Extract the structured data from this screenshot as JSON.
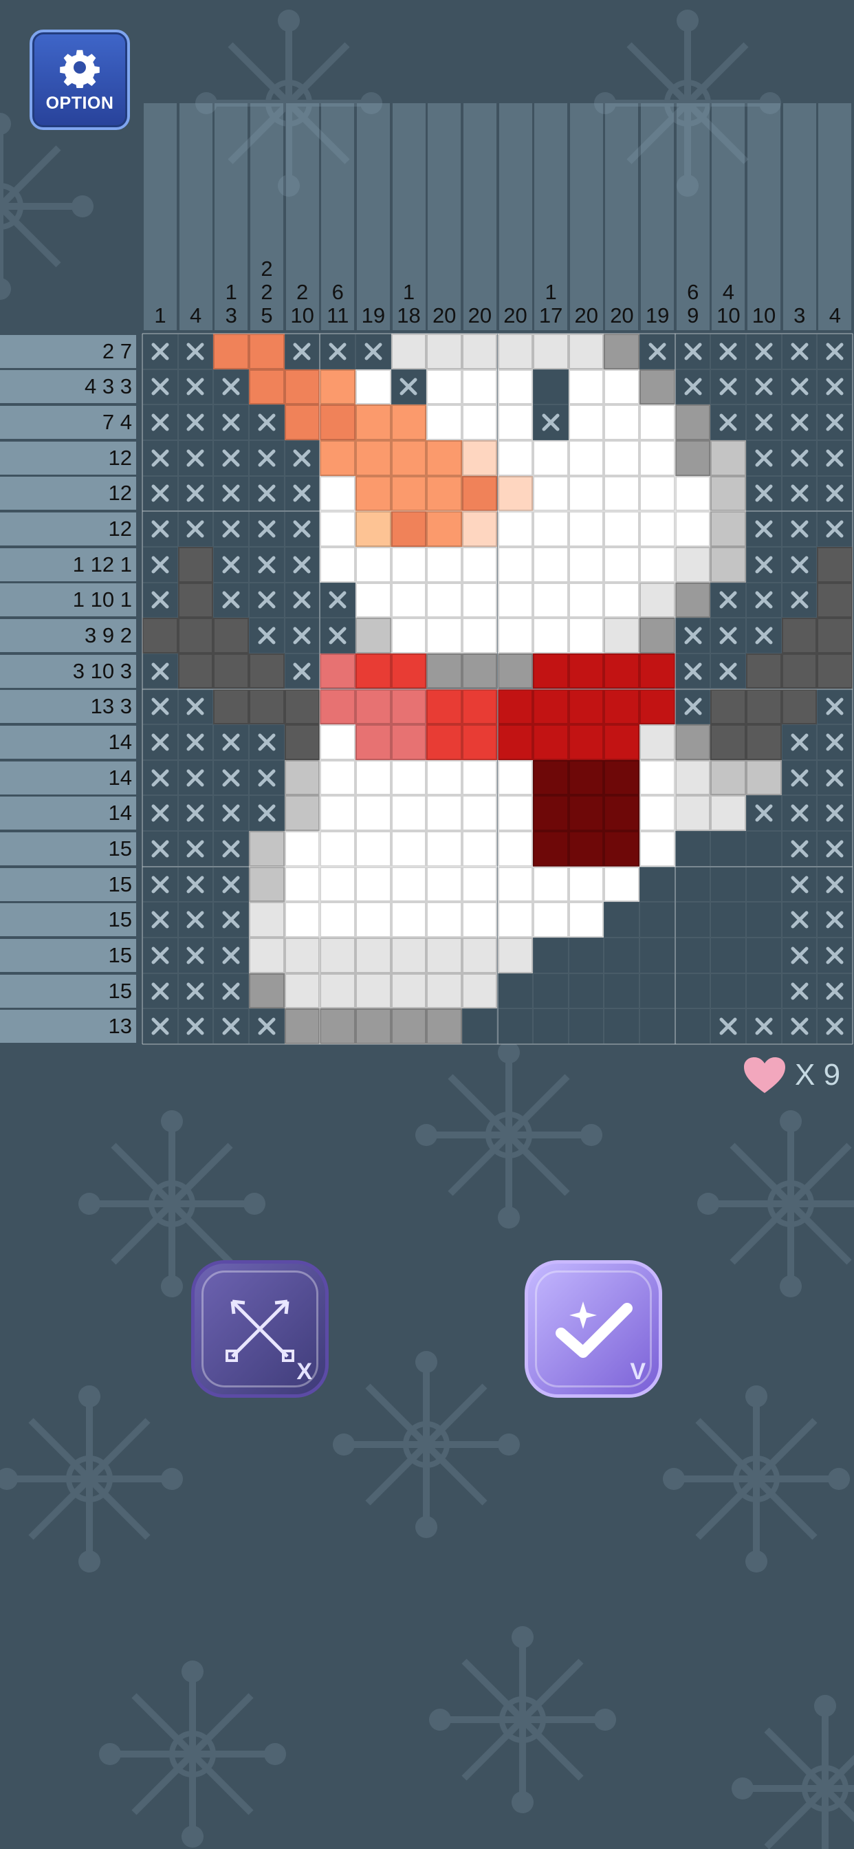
{
  "option_button": {
    "label": "OPTION",
    "icon": "gear-icon"
  },
  "column_clues": [
    [
      "1"
    ],
    [
      "4"
    ],
    [
      "1",
      "3"
    ],
    [
      "2",
      "2",
      "5"
    ],
    [
      "2",
      "10"
    ],
    [
      "6",
      "11"
    ],
    [
      "19"
    ],
    [
      "1",
      "18"
    ],
    [
      "20"
    ],
    [
      "20"
    ],
    [
      "20"
    ],
    [
      "1",
      "17"
    ],
    [
      "20"
    ],
    [
      "20"
    ],
    [
      "19"
    ],
    [
      "6",
      "9"
    ],
    [
      "4",
      "10"
    ],
    [
      "10"
    ],
    [
      "3"
    ],
    [
      "4"
    ]
  ],
  "row_clues": [
    "2 7",
    "4 3 3",
    "7 4",
    "12",
    "12",
    "12",
    "1 12 1",
    "1 10 1",
    "3 9 2",
    "3 10 3",
    "13 3",
    "14",
    "14",
    "14",
    "15",
    "15",
    "15",
    "15",
    "15",
    "13"
  ],
  "colors": {
    "E": "#3c505d",
    "W": "#ffffff",
    "L": "#e4e4e4",
    "M": "#c4c4c4",
    "G": "#9a9a9a",
    "D": "#5a5a5a",
    "O": "#f08259",
    "o": "#fb9a6c",
    "y": "#fdc394",
    "p": "#fed6c0",
    "r": "#e83c34",
    "s": "#e77272",
    "R": "#c21313",
    "K": "#6e0808"
  },
  "grid": [
    "XXOOXXXLLLLLLGXXXXXX",
    "XXXOOoWXWWWEWWGXXXXX",
    "XXXXOOooWWWXWWWGXXXX",
    "XXXXXoooopWWWWWGMXXX",
    "XXXXXWoooOpWWWWWMXXX",
    "XXXXXWyOopWWWWWWMXXX",
    "XDXXXWWWWWWWWWWLMXXD",
    "XDXXXXWWWWWWWWLGXXXD",
    "DDDXXXMWWWWWWLGXXXDD",
    "XDDDXsrrGGGRRRRXXDDD",
    "XXDDDsssrrRRRRRXDDDX",
    "XXXXDWssrrRRRRLGDDXX",
    "XXXXMWWWWWWKKKWLMMXX",
    "XXXXMWWWWWWKKKWLLXXX",
    "XXXMWWWWWWWKKKWEEEXX",
    "XXXMWWWWWWWWWWEEEEXX",
    "XXXLWWWWWWWWWEEEEEXX",
    "XXXLLLLLLLLEEEEEEEXX",
    "XXXGLLLLLLEEEEEEEEXX",
    "XXXXGGGGGEEEEEEEXXXX"
  ],
  "lives": {
    "icon": "heart-icon",
    "count": "X 9"
  },
  "buttons": {
    "cancel": {
      "icon": "crossed-arrows-icon",
      "key": "X"
    },
    "confirm": {
      "icon": "checkmark-sparkle-icon",
      "key": "V"
    }
  }
}
